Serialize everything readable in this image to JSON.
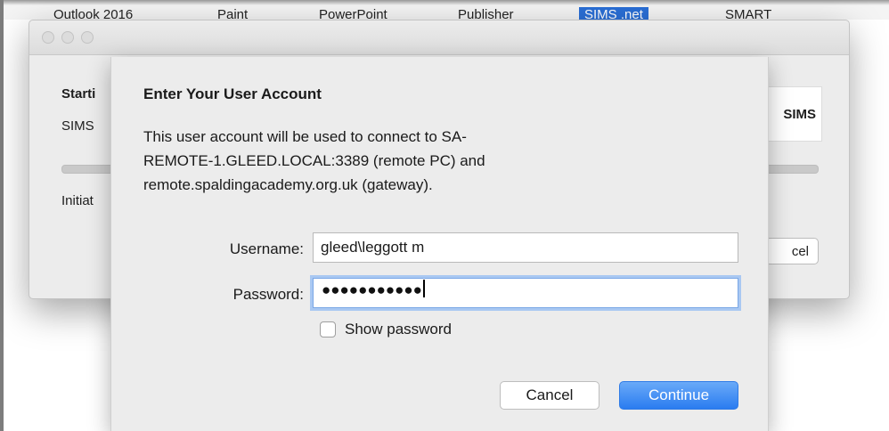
{
  "topbar": {
    "items": [
      "Outlook 2016",
      "Paint",
      "PowerPoint",
      "Publisher",
      "SIMS .net",
      "SMART"
    ],
    "selected_index": 4
  },
  "background_window": {
    "heading": "Starti",
    "app_text": "SIMS",
    "status_text": "Initiat",
    "logo_text": "SIMS",
    "cancel_label": "cel"
  },
  "dialog": {
    "heading": "Enter Your User Account",
    "description_lines": [
      "This user account will be used to connect to SA-",
      "REMOTE-1.GLEED.LOCAL:3389 (remote PC) and",
      "remote.spaldingacademy.org.uk (gateway)."
    ],
    "username_label": "Username:",
    "username_value": "gleed\\leggott m",
    "password_label": "Password:",
    "password_masked": "●●●●●●●●●●●",
    "show_password_label": "Show password",
    "show_password_checked": false,
    "cancel_label": "Cancel",
    "continue_label": "Continue"
  },
  "colors": {
    "accent": "#2a7cf0",
    "focus_ring": "#a9c8f2",
    "window_bg": "#ececec"
  }
}
